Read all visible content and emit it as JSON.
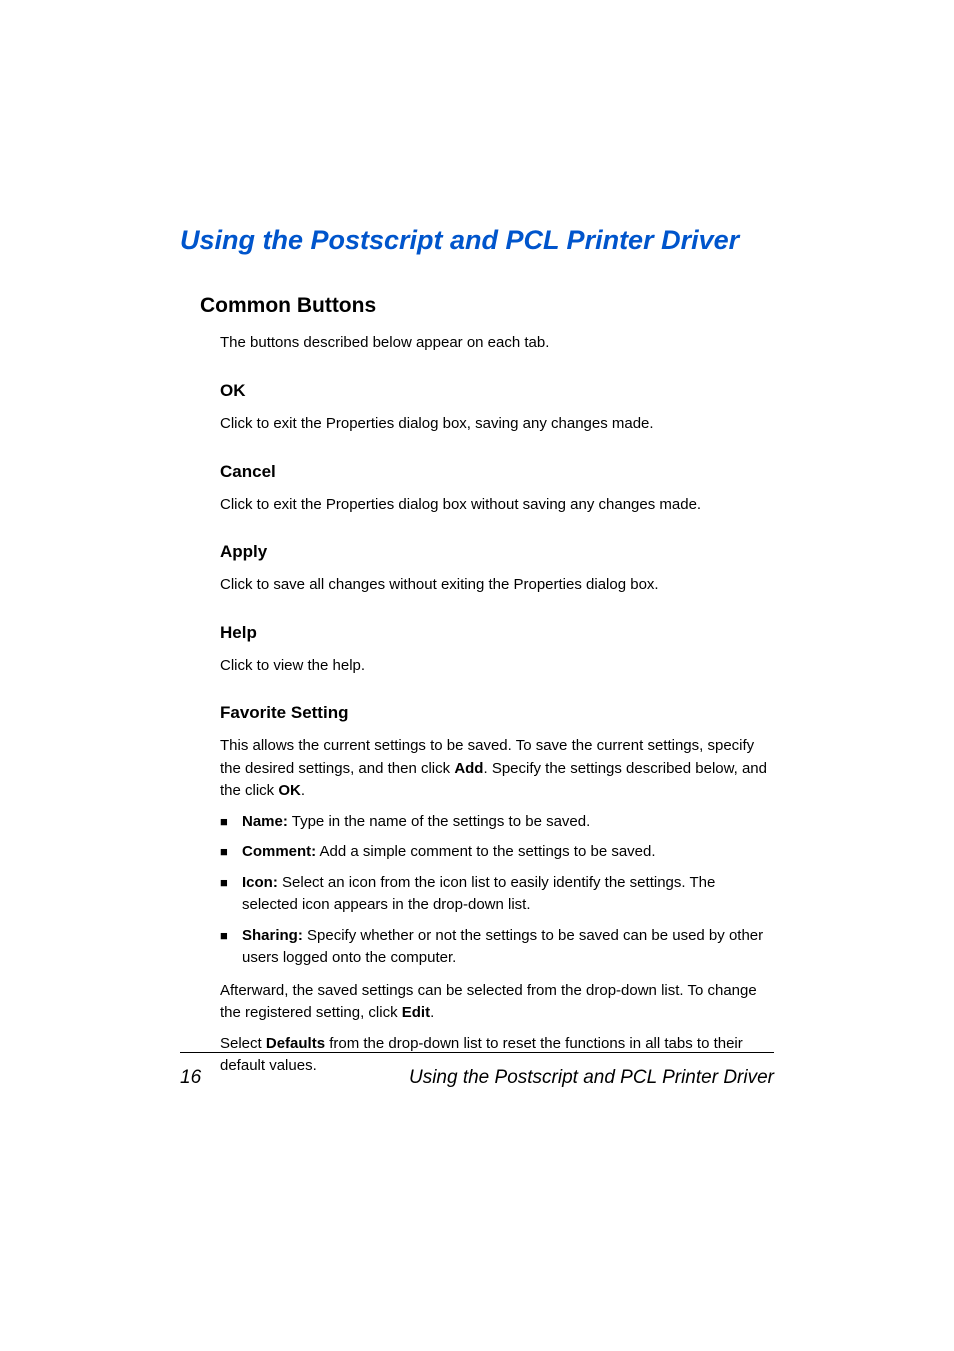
{
  "main_title": "Using the Postscript and PCL Printer Driver",
  "section_title": "Common Buttons",
  "section_intro": "The buttons described below appear on each tab.",
  "subsections": {
    "ok": {
      "title": "OK",
      "text": "Click to exit the Properties dialog box, saving any changes made."
    },
    "cancel": {
      "title": "Cancel",
      "text": "Click to exit the Properties dialog box without saving any changes made."
    },
    "apply": {
      "title": "Apply",
      "text": "Click to save all changes without exiting the Properties dialog box."
    },
    "help": {
      "title": "Help",
      "text": "Click to view the help."
    },
    "favorite": {
      "title": "Favorite Setting",
      "intro_pre": "This allows the current settings to be saved. To save the current settings, specify the desired settings, and then click ",
      "intro_bold1": "Add",
      "intro_mid": ". Specify the settings described below, and the click ",
      "intro_bold2": "OK",
      "intro_end": ".",
      "bullets": [
        {
          "label": "Name:",
          "text": " Type in the name of the settings to be saved."
        },
        {
          "label": "Comment:",
          "text": " Add a simple comment to the settings to be saved."
        },
        {
          "label": "Icon:",
          "text": " Select an icon from the icon list to easily identify the settings. The selected icon appears in the drop-down list."
        },
        {
          "label": "Sharing:",
          "text": " Specify whether or not the settings to be saved can be used by other users logged onto the computer."
        }
      ],
      "after1_pre": "Afterward, the saved settings can be selected from the drop-down list. To change the registered setting, click ",
      "after1_bold": "Edit",
      "after1_end": ".",
      "after2_pre": "Select ",
      "after2_bold": "Defaults",
      "after2_end": " from the drop-down list to reset the functions in all tabs to their default values."
    }
  },
  "footer": {
    "page_number": "16",
    "title": "Using the Postscript and PCL Printer Driver"
  }
}
